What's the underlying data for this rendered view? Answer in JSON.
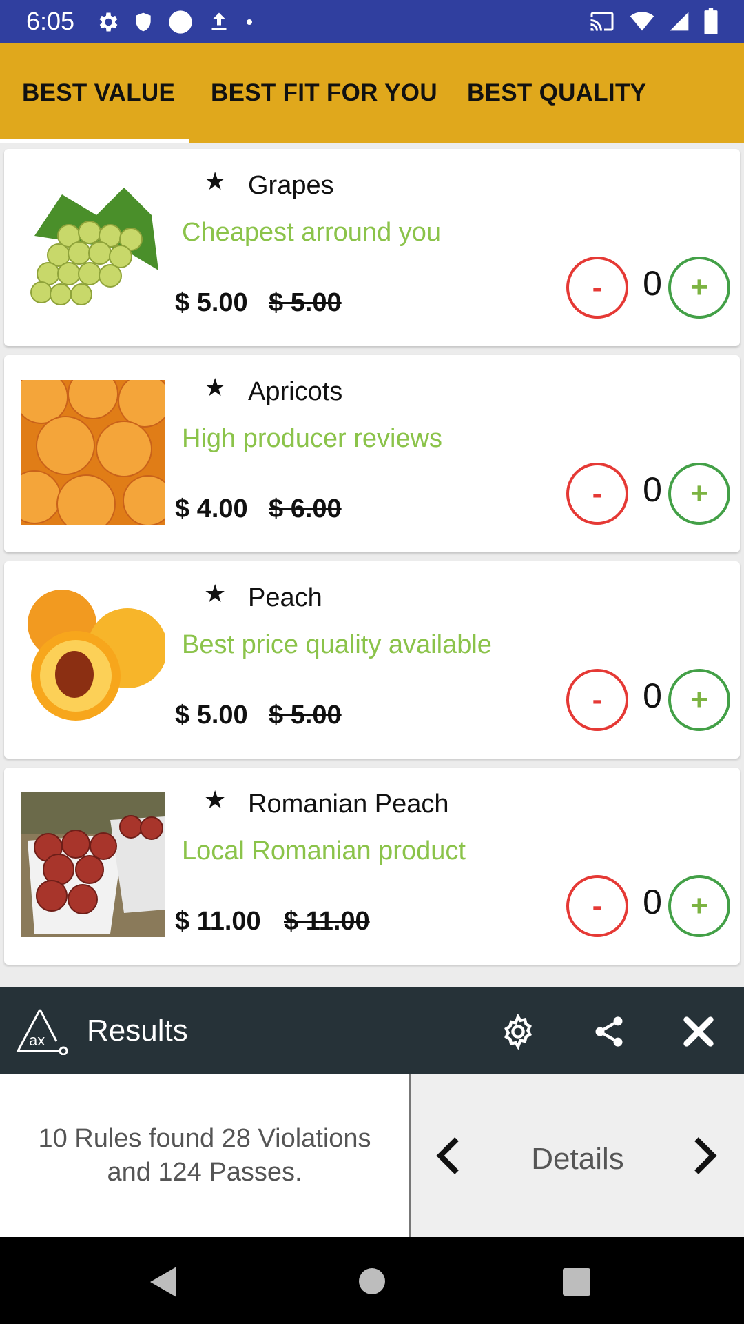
{
  "status_bar": {
    "time": "6:05"
  },
  "tabs": [
    {
      "label": "BEST VALUE",
      "selected": true
    },
    {
      "label": "BEST FIT FOR YOU",
      "selected": false
    },
    {
      "label": "BEST QUALITY",
      "selected": false
    }
  ],
  "products": [
    {
      "name": "Grapes",
      "tagline": "Cheapest arround you",
      "price": "$ 5.00",
      "old_price": "$ 5.00",
      "quantity": "0",
      "image": "grapes"
    },
    {
      "name": "Apricots",
      "tagline": "High producer reviews",
      "price": "$ 4.00",
      "old_price": "$ 6.00",
      "quantity": "0",
      "image": "apricots"
    },
    {
      "name": "Peach",
      "tagline": "Best price quality available",
      "price": "$ 5.00",
      "old_price": "$ 5.00",
      "quantity": "0",
      "image": "peach"
    },
    {
      "name": "Romanian Peach",
      "tagline": "Local Romanian product",
      "price": "$ 11.00",
      "old_price": "$ 11.00",
      "quantity": "0",
      "image": "romanian-peach"
    }
  ],
  "buttons": {
    "minus": "-",
    "plus": "+",
    "star": "★"
  },
  "ax_panel": {
    "title": "Results",
    "logo_text": "ax",
    "summary": "10 Rules found 28 Violations and 124 Passes.",
    "details_label": "Details"
  },
  "colors": {
    "status_bar": "#303f9f",
    "tab_bar": "#e0a81c",
    "tagline": "#8bc34a",
    "minus": "#e53935",
    "plus": "#43a047",
    "ax_bar": "#263238"
  }
}
